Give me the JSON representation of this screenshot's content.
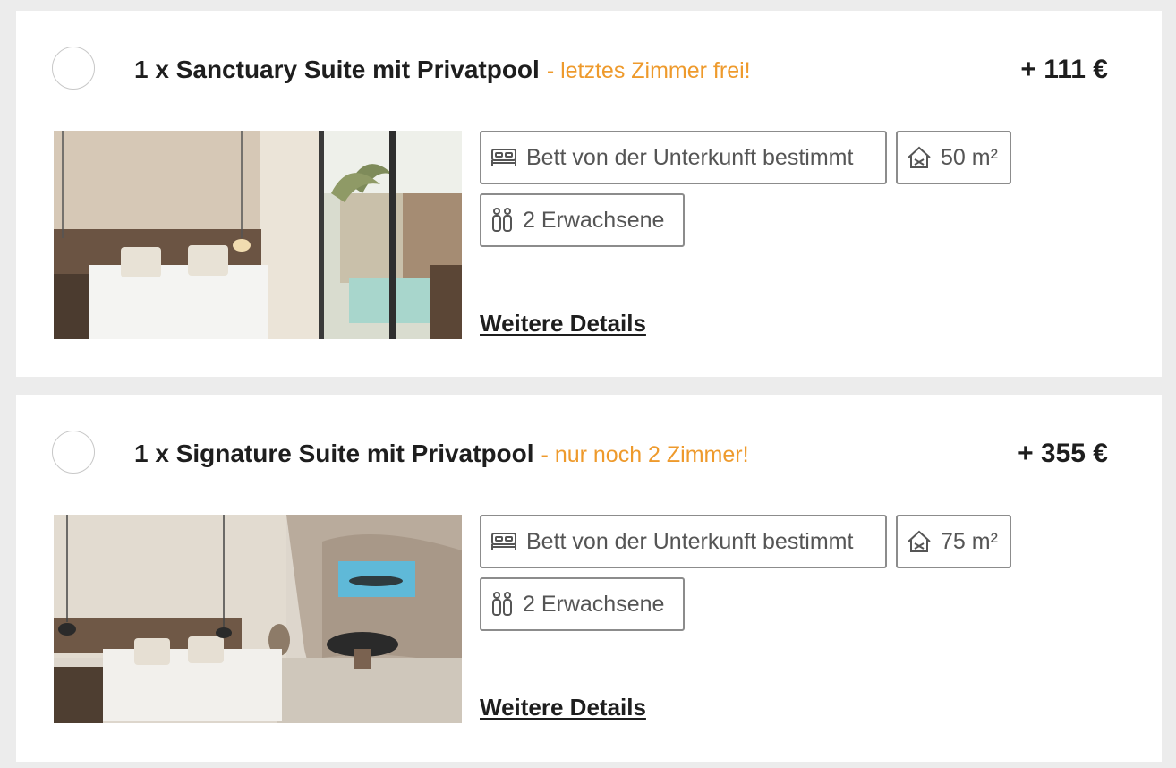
{
  "rooms": [
    {
      "title": "1 x Sanctuary Suite mit Privatpool",
      "availability": "- letztes Zimmer frei!",
      "price": "+ 111 €",
      "bed_label": "Bett von der Unterkunft bestimmt",
      "size_label": "50 m²",
      "persons_label": "2 Erwachsene",
      "details_label": "Weitere Details"
    },
    {
      "title": "1 x Signature Suite mit Privatpool",
      "availability": "- nur noch 2 Zimmer!",
      "price": "+ 355 €",
      "bed_label": "Bett von der Unterkunft bestimmt",
      "size_label": "75 m²",
      "persons_label": "2 Erwachsene",
      "details_label": "Weitere Details"
    }
  ],
  "icons": {
    "bed": "bed-icon",
    "size": "room-size-icon",
    "persons": "persons-icon"
  },
  "colors": {
    "availability": "#ee9a2c",
    "background": "#ececec",
    "card": "#ffffff"
  }
}
